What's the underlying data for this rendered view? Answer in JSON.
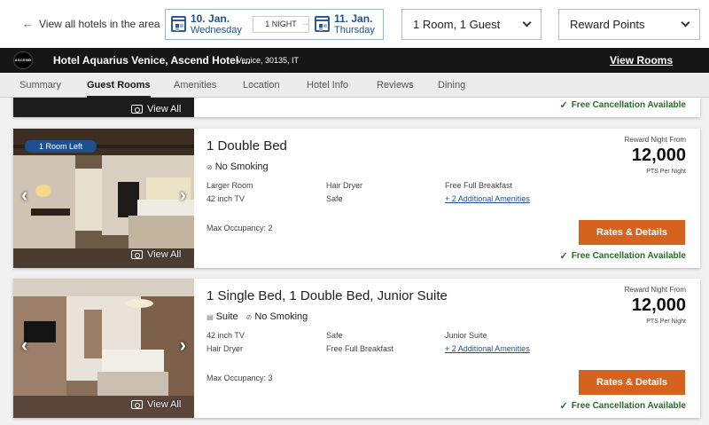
{
  "nav": {
    "back_label": "View all hotels in the area"
  },
  "dates": {
    "check_in_date": "10. Jan.",
    "check_in_day": "Wednesday",
    "nights": "1 NIGHT",
    "check_out_date": "11. Jan.",
    "check_out_day": "Thursday"
  },
  "rooms_guests": {
    "value": "1 Room, 1 Guest"
  },
  "rate_type": {
    "value": "Reward Points"
  },
  "hotel": {
    "logo_text": "ASCEND",
    "name": "Hotel Aquarius Venice, Ascend Hotel ...",
    "location": "Venice, 30135, IT",
    "view_rooms": "View Rooms"
  },
  "tabs": [
    "Summary",
    "Guest Rooms",
    "Amenities",
    "Location",
    "Hotel Info",
    "Reviews",
    "Dining"
  ],
  "active_tab": "Guest Rooms",
  "common": {
    "view_all": "View All",
    "reward_label": "Reward Night From",
    "pts_label": "PTS Per Night",
    "rates_button": "Rates & Details",
    "free_cancel": "Free Cancellation Available"
  },
  "rooms": [
    {
      "badge": "1 Room Left",
      "title": "1 Double Bed",
      "tags": [
        "No Smoking"
      ],
      "amenities": [
        "Larger Room",
        "Hair Dryer",
        "Free Full Breakfast",
        "42 inch TV",
        "Safe"
      ],
      "more_amenities": "+ 2 Additional Amenities",
      "occupancy": "Max Occupancy: 2",
      "price": "12,000"
    },
    {
      "badge": "",
      "title": "1 Single Bed, 1 Double Bed, Junior Suite",
      "tags": [
        "Suite",
        "No Smoking"
      ],
      "amenities": [
        "42 inch TV",
        "Safe",
        "Junior Suite",
        "Hair Dryer",
        "Free Full Breakfast"
      ],
      "more_amenities": "+ 2 Additional Amenities",
      "occupancy": "Max Occupancy: 3",
      "price": "12,000"
    }
  ],
  "colors": {
    "brand_blue": "#1f4f8f",
    "cta_orange": "#d5621d",
    "success_green": "#2b6a2b",
    "hotel_bar": "#161616"
  },
  "icons": [
    "arrow-left-icon",
    "calendar-icon",
    "chevron-down-icon",
    "camera-icon",
    "no-smoking-icon",
    "suite-icon",
    "check-icon",
    "chevron-left-icon",
    "chevron-right-icon"
  ]
}
